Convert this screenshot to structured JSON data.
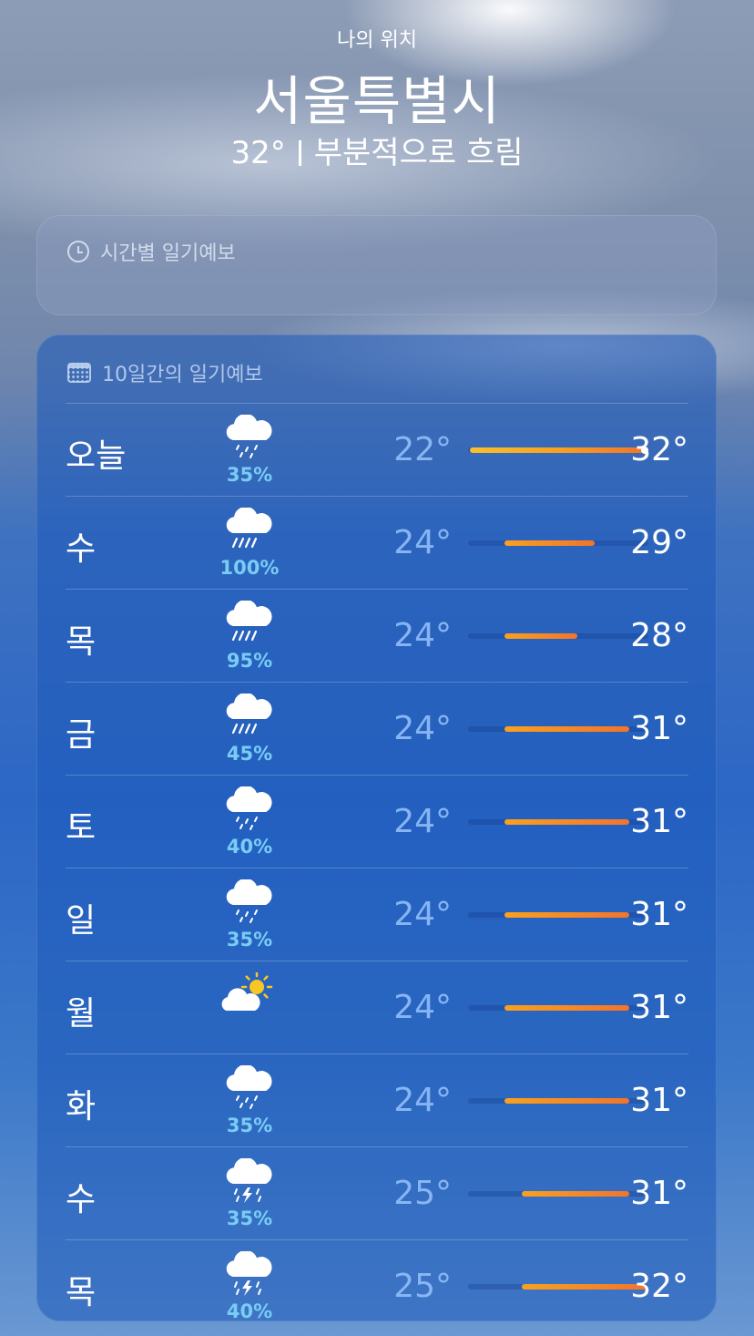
{
  "header": {
    "location_label": "나의 위치",
    "city": "서울특별시",
    "current_temp": "32°",
    "condition": "부분적으로 흐림"
  },
  "hourly_card": {
    "title": "시간별 일기예보",
    "icon": "clock-icon"
  },
  "daily_card": {
    "title": "10일간의 일기예보",
    "icon": "calendar-icon"
  },
  "days": [
    {
      "day": "오늘",
      "icon": "cloud-drizzle",
      "pop": "35%",
      "low": "22°",
      "high": "32°",
      "range": [
        22,
        32
      ],
      "current": 32
    },
    {
      "day": "수",
      "icon": "cloud-rain",
      "pop": "100%",
      "low": "24°",
      "high": "29°",
      "range": [
        24,
        29
      ]
    },
    {
      "day": "목",
      "icon": "cloud-rain",
      "pop": "95%",
      "low": "24°",
      "high": "28°",
      "range": [
        24,
        28
      ]
    },
    {
      "day": "금",
      "icon": "cloud-rain",
      "pop": "45%",
      "low": "24°",
      "high": "31°",
      "range": [
        24,
        31
      ]
    },
    {
      "day": "토",
      "icon": "cloud-drizzle",
      "pop": "40%",
      "low": "24°",
      "high": "31°",
      "range": [
        24,
        31
      ]
    },
    {
      "day": "일",
      "icon": "cloud-drizzle",
      "pop": "35%",
      "low": "24°",
      "high": "31°",
      "range": [
        24,
        31
      ]
    },
    {
      "day": "월",
      "icon": "cloud-sun",
      "pop": "",
      "low": "24°",
      "high": "31°",
      "range": [
        24,
        31
      ]
    },
    {
      "day": "화",
      "icon": "cloud-drizzle",
      "pop": "35%",
      "low": "24°",
      "high": "31°",
      "range": [
        24,
        31
      ]
    },
    {
      "day": "수",
      "icon": "cloud-bolt-rain",
      "pop": "35%",
      "low": "25°",
      "high": "31°",
      "range": [
        25,
        31
      ]
    },
    {
      "day": "목",
      "icon": "cloud-bolt-rain",
      "pop": "40%",
      "low": "25°",
      "high": "32°",
      "range": [
        25,
        32
      ]
    }
  ],
  "range_scale": [
    22,
    32
  ],
  "colors": {
    "bar_start": "#f9c02d",
    "bar_mid": "#f8a11f",
    "bar_end": "#f2742d",
    "pop": "#79cdf5"
  }
}
